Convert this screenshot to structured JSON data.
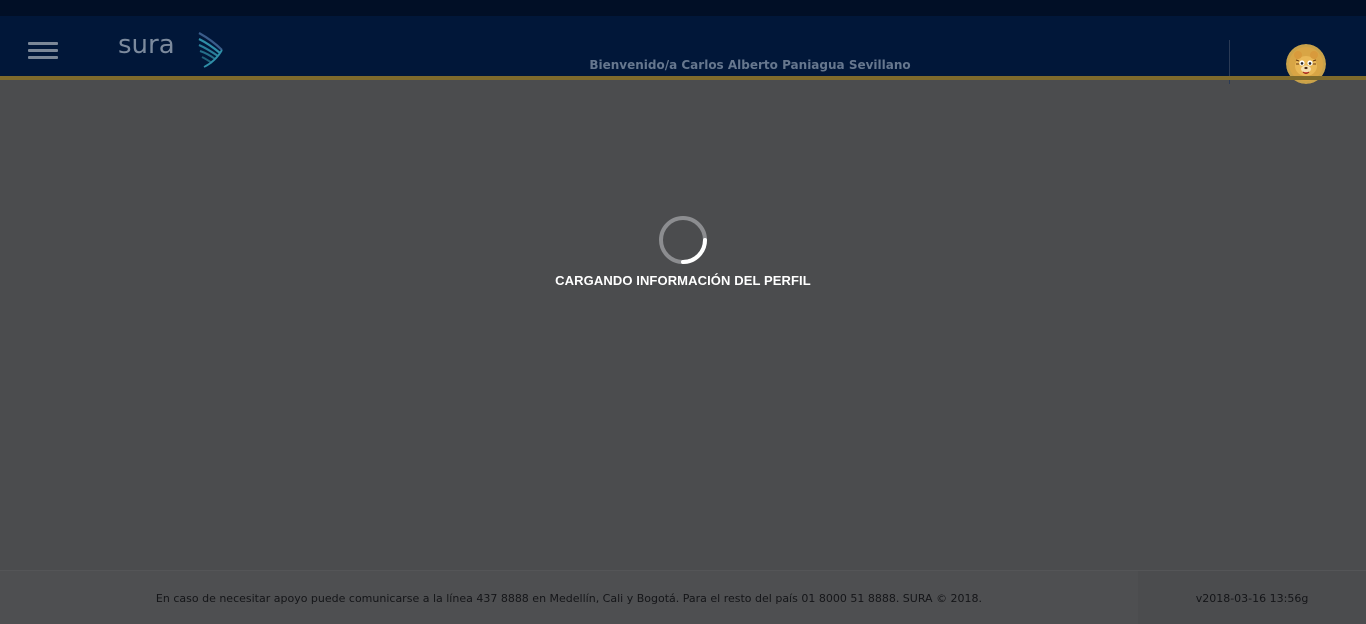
{
  "header": {
    "brand": "sura",
    "welcome": "Bienvenido/a Carlos Alberto Paniagua Sevillano",
    "menu_icon": "hamburger-menu-icon",
    "avatar_icon": "tiger-mascot-avatar"
  },
  "loader": {
    "message": "CARGANDO INFORMACIÓN DEL PERFIL",
    "icon": "loading-spinner-icon"
  },
  "footer": {
    "support_text": "En caso de necesitar apoyo puede comunicarse a la línea 437 8888 en Medellín, Cali y Bogotá. Para el resto del país 01 8000 51 8888. SURA © 2018.",
    "version": "v2018-03-16 13:56g"
  },
  "colors": {
    "header_bg": "#011739",
    "accent": "#c9a227",
    "overlay": "#4b4c4e",
    "loading_text": "#ffffff"
  }
}
